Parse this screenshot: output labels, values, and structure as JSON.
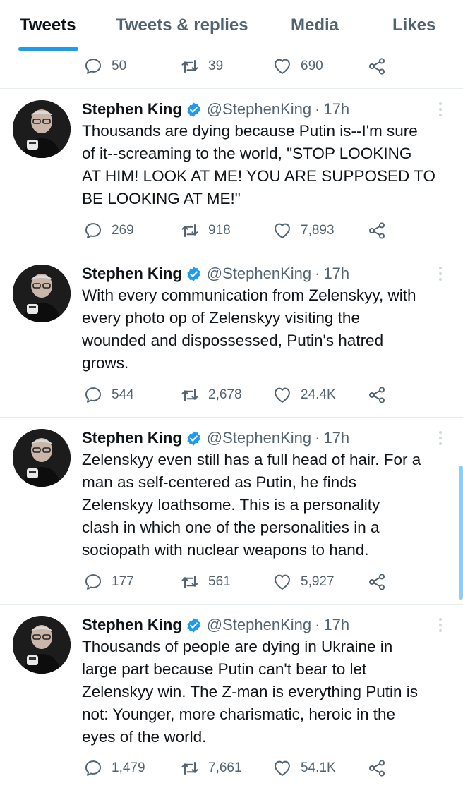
{
  "tabs": [
    {
      "label": "Tweets",
      "active": true
    },
    {
      "label": "Tweets & replies",
      "active": false
    },
    {
      "label": "Media",
      "active": false
    },
    {
      "label": "Likes",
      "active": false
    }
  ],
  "top_actions": {
    "replies": "50",
    "retweets": "39",
    "likes": "690"
  },
  "tweets": [
    {
      "name": "Stephen King",
      "handle": "@StephenKing",
      "separator": "·",
      "time": "17h",
      "text": "Thousands are dying because Putin is--I'm sure\nof it--screaming to the world, \"STOP LOOKING\nAT HIM! LOOK AT ME! YOU ARE SUPPOSED TO\nBE LOOKING AT ME!\"",
      "replies": "269",
      "retweets": "918",
      "likes": "7,893"
    },
    {
      "name": "Stephen King",
      "handle": "@StephenKing",
      "separator": "·",
      "time": "17h",
      "text": "With every communication from Zelenskyy, with\nevery photo op of Zelenskyy visiting the\nwounded and dispossessed, Putin's hatred\ngrows.",
      "replies": "544",
      "retweets": "2,678",
      "likes": "24.4K"
    },
    {
      "name": "Stephen King",
      "handle": "@StephenKing",
      "separator": "·",
      "time": "17h",
      "text": "Zelenskyy even still has a full head of hair. For a\nman as self-centered as Putin, he finds\nZelenskyy loathsome. This is a personality\nclash in which one of the personalities in a\nsociopath with nuclear weapons to hand.",
      "replies": "177",
      "retweets": "561",
      "likes": "5,927"
    },
    {
      "name": "Stephen King",
      "handle": "@StephenKing",
      "separator": "·",
      "time": "17h",
      "text": "Thousands of people are dying in Ukraine in\nlarge part because Putin can't bear to let\nZelenskyy win. The Z-man is everything Putin is\nnot: Younger, more charismatic, heroic in the\neyes of the world.",
      "replies": "1,479",
      "retweets": "7,661",
      "likes": "54.1K"
    }
  ],
  "icons": {
    "reply": "reply-icon",
    "retweet": "retweet-icon",
    "like": "heart-icon",
    "share": "share-icon",
    "verified": "verified-badge-icon",
    "more": "more-vertical-icon"
  },
  "colors": {
    "accent": "#1d9bf0",
    "text": "#0f1419",
    "secondary": "#536471",
    "divider": "#e6ecf0"
  }
}
